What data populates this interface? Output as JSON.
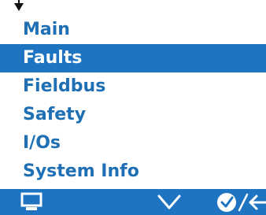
{
  "menu": {
    "items": [
      {
        "label": "Main",
        "selected": false
      },
      {
        "label": "Faults",
        "selected": true
      },
      {
        "label": "Fieldbus",
        "selected": false
      },
      {
        "label": "Safety",
        "selected": false
      },
      {
        "label": "I/Os",
        "selected": false
      },
      {
        "label": "System Info",
        "selected": false
      }
    ]
  },
  "softkeys": {
    "left_icon": "monitor-icon",
    "middle_icon": "chevron-down-icon",
    "right_icons": [
      "check-circle-icon",
      "back-arrow-icon"
    ],
    "right_separator": "/"
  },
  "colors": {
    "accent": "#1e74c1",
    "menu_text": "#1f6fb5",
    "selected_text": "#ffffff",
    "background": "#ffffff"
  }
}
